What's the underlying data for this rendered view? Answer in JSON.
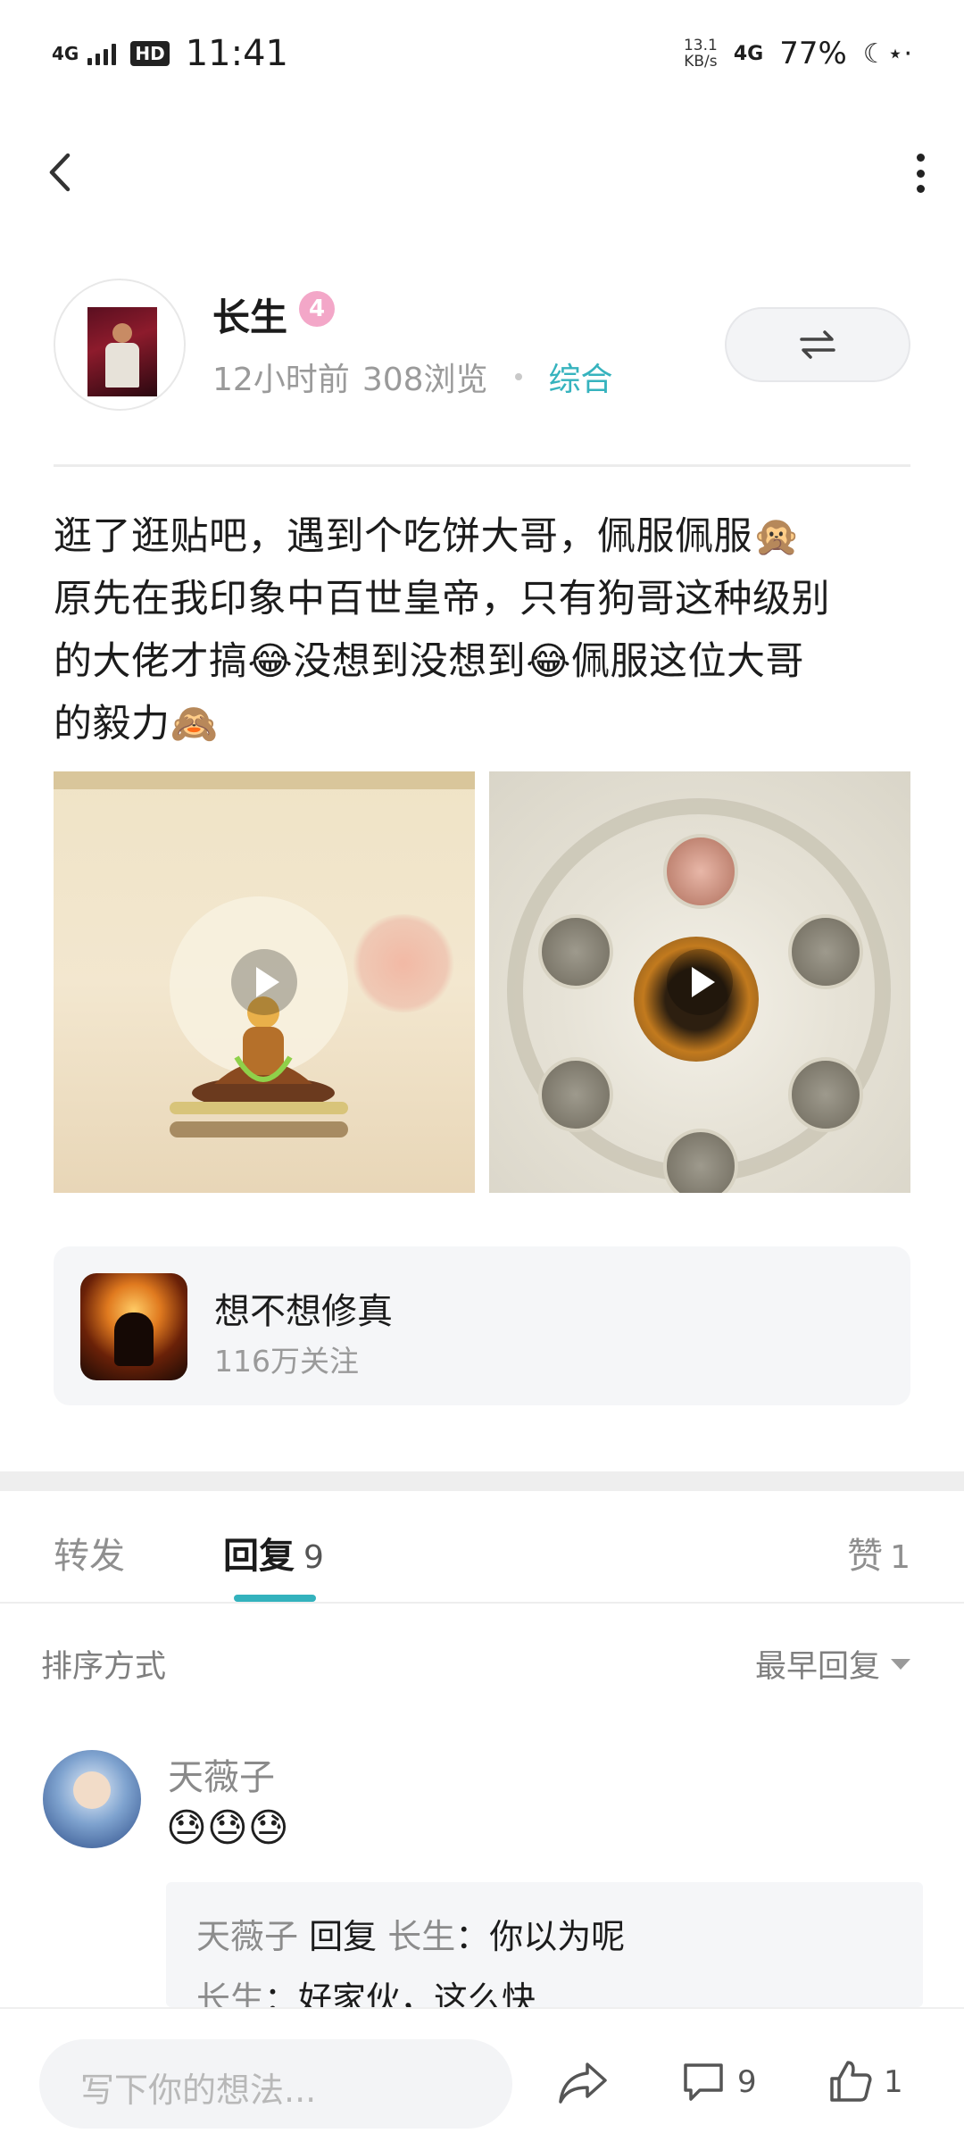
{
  "status_bar": {
    "network": "4G",
    "hd": "HD",
    "time": "11:41",
    "speed_value": "13.1",
    "speed_unit": "KB/s",
    "network_right": "4G",
    "battery": "77%"
  },
  "post": {
    "author": {
      "name": "长生",
      "level": "4",
      "time_ago": "12小时前",
      "views": "308浏览",
      "category": "综合"
    },
    "text_lines": [
      "逛了逛贴吧，遇到个吃饼大哥，佩服佩服🙊",
      "原先在我印象中百世皇帝，只有狗哥这种级别",
      "的大佬才搞😂没想到没想到😂佩服这位大哥",
      "的毅力🙈"
    ],
    "media": [
      {
        "type": "video",
        "icon": "play-icon"
      },
      {
        "type": "video",
        "icon": "play-icon"
      }
    ],
    "app_card": {
      "name": "想不想修真",
      "followers": "116万关注"
    }
  },
  "tabs": {
    "forward": "转发",
    "reply": "回复",
    "reply_count": "9",
    "like": "赞",
    "like_count": "1"
  },
  "sort": {
    "label": "排序方式",
    "value": "最早回复"
  },
  "comments": [
    {
      "name": "天薇子",
      "content": "😓😓😓",
      "replies": [
        {
          "from": "天薇子",
          "verb": "回复",
          "to": "长生",
          "text": "：你以为呢"
        },
        {
          "from": "长生",
          "text": "：好家伙，这么快"
        }
      ]
    }
  ],
  "bottom_bar": {
    "compose_placeholder": "写下你的想法...",
    "comment_count": "9",
    "like_count": "1"
  },
  "colors": {
    "accent": "#33b2bd",
    "category": "#36b3be",
    "level_badge": "#f3a7c8"
  }
}
